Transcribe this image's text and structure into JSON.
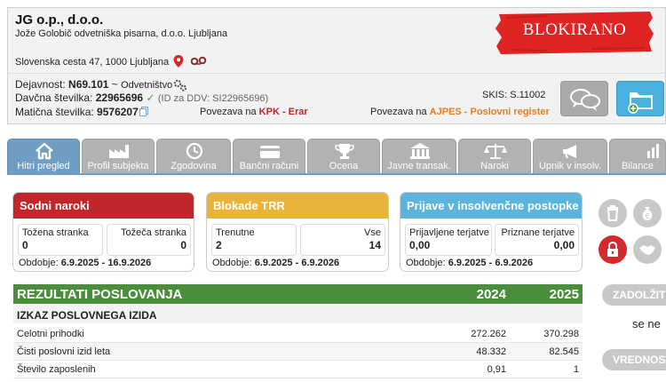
{
  "company": {
    "name": "JG o.p., d.o.o.",
    "full_name": "Jože Golobič odvetniška pisarna, d.o.o. Ljubljana",
    "address": "Slovenska cesta 47, 1000 Ljubljana",
    "status": "BLOKIRANO"
  },
  "info": {
    "activity_label": "Dejavnost:",
    "activity_code": "N69.101",
    "activity_sep": "~",
    "activity_name": "Odvetništvo",
    "tax_label": "Davčna številka:",
    "tax_number": "22965696",
    "vat_id": "(ID za DDV: SI22965696)",
    "reg_label": "Matična številka:",
    "reg_number": "9576207",
    "link_kpk_prefix": "Povezava na",
    "link_kpk": "KPK - Erar",
    "skis_label": "SKIS:",
    "skis_value": "S.11002",
    "link_ajpes_prefix": "Povezava na",
    "link_ajpes": "AJPES - Poslovni register"
  },
  "tabs": [
    {
      "label": "Hitri pregled",
      "icon": "home-icon"
    },
    {
      "label": "Profil subjekta",
      "icon": "factory-icon"
    },
    {
      "label": "Zgodovina",
      "icon": "clock-icon"
    },
    {
      "label": "Bančni računi",
      "icon": "card-icon"
    },
    {
      "label": "Ocena",
      "icon": "trophy-icon"
    },
    {
      "label": "Javne transak.",
      "icon": "building-icon"
    },
    {
      "label": "Naroki",
      "icon": "scales-icon"
    },
    {
      "label": "Upnik v insolv.",
      "icon": "megaphone-icon"
    },
    {
      "label": "Bilance",
      "icon": "chart-icon"
    }
  ],
  "boxes": {
    "court": {
      "title": "Sodni naroki",
      "left_label": "Tožena stranka",
      "left_value": "0",
      "right_label": "Tožeča stranka",
      "right_value": "0",
      "period_label": "Obdobje:",
      "period_value": "6.9.2025 - 16.9.2026"
    },
    "trr": {
      "title": "Blokade TRR",
      "left_label": "Trenutne",
      "left_value": "2",
      "right_label": "Vse",
      "right_value": "14",
      "period_label": "Obdobje:",
      "period_value": "6.9.2025 - 6.9.2026"
    },
    "insolvency": {
      "title": "Prijave v insolvenčne postopke",
      "left_label": "Prijavljene terjatve",
      "left_value": "0,00",
      "right_label": "Priznane terjatve",
      "right_value": "0,00",
      "period_label": "Obdobje:",
      "period_value": "6.9.2025 - 6.9.2026"
    }
  },
  "results": {
    "title": "REZULTATI POSLOVANJA",
    "year1": "2024",
    "year2": "2025",
    "section": "IZKAZ POSLOVNEGA IZIDA",
    "rows": [
      {
        "label": "Celotni prihodki",
        "v1": "272.262",
        "v2": "370.298"
      },
      {
        "label": "Čisti poslovni izid leta",
        "v1": "48.332",
        "v2": "82.545"
      },
      {
        "label": "Število zaposlenih",
        "v1": "0,91",
        "v2": "1"
      }
    ]
  },
  "side": {
    "pill1": "ZADOLŽITEV",
    "text": "se ne",
    "pill2": "VREDNOSTI"
  },
  "colors": {
    "red": "#c0262a",
    "yellow": "#e9b43a",
    "blue": "#5cb4da",
    "green": "#4a8e3c",
    "tab_active": "#6f9ec2",
    "tab_inactive": "#b2b2b2"
  }
}
